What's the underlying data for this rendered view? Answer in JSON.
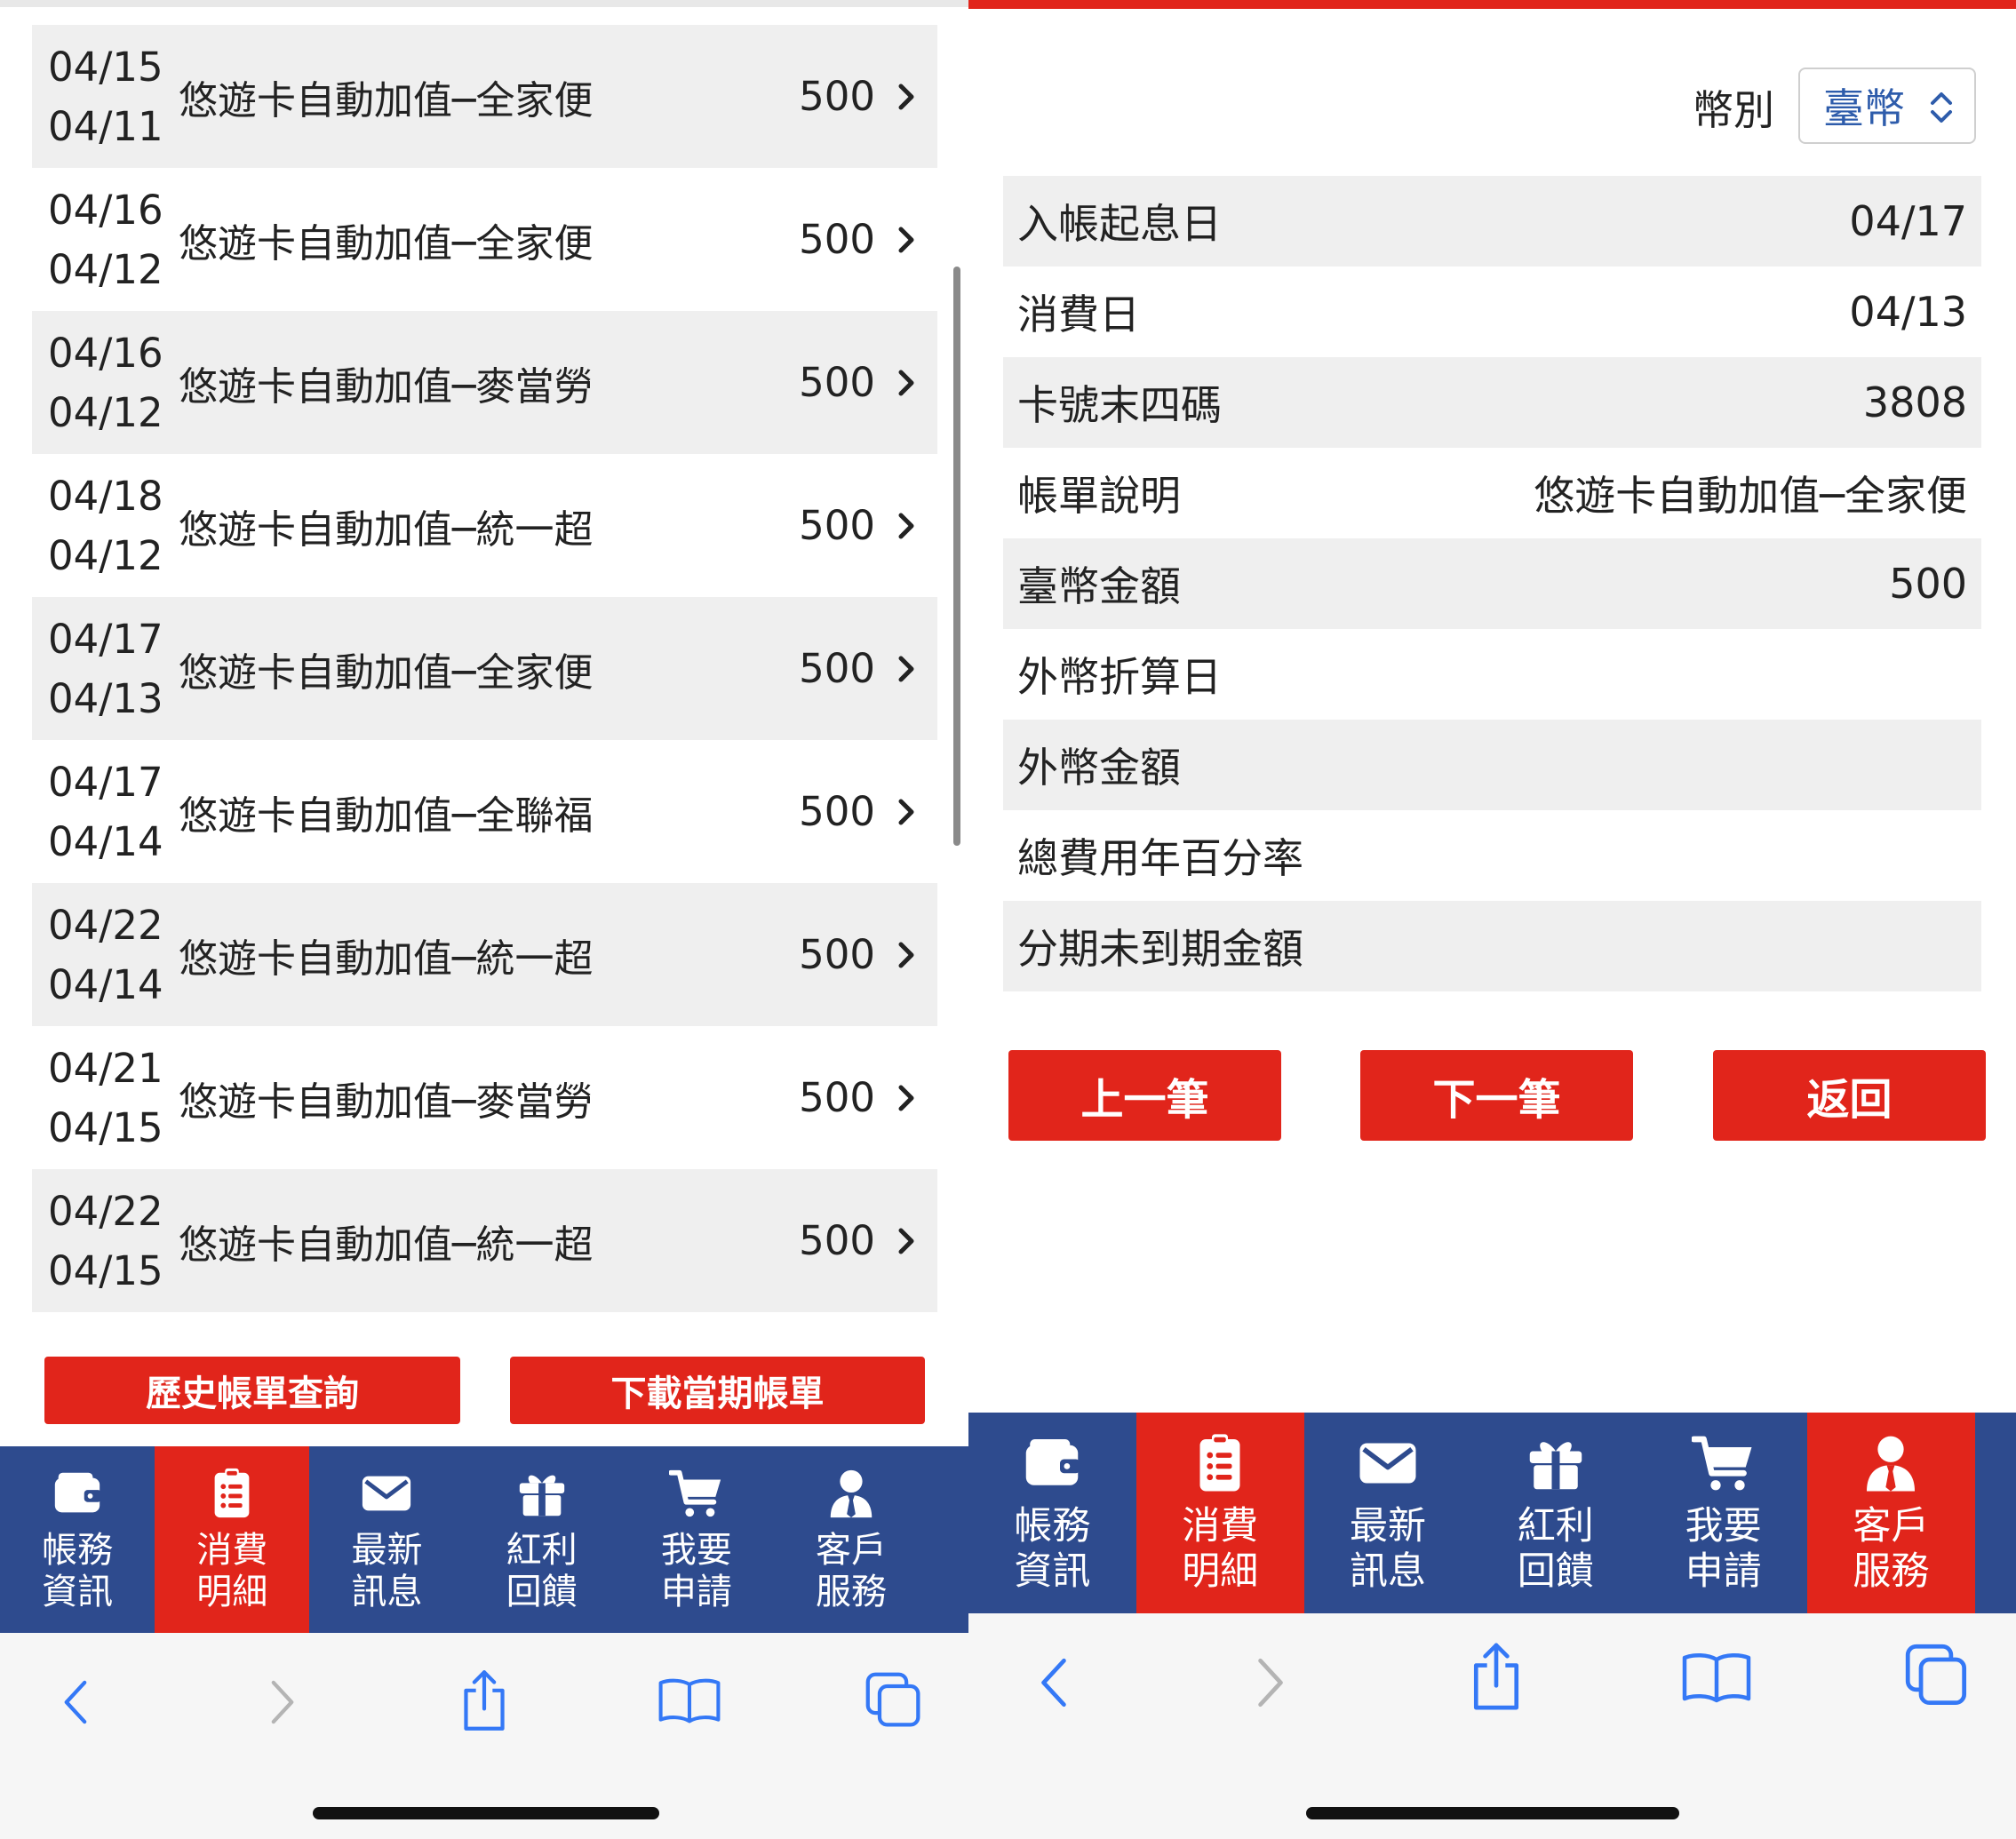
{
  "left": {
    "transactions": [
      {
        "post_date": "04/15",
        "txn_date": "04/11",
        "description": "悠遊卡自動加值─全家便",
        "amount": "500"
      },
      {
        "post_date": "04/16",
        "txn_date": "04/12",
        "description": "悠遊卡自動加值─全家便",
        "amount": "500"
      },
      {
        "post_date": "04/16",
        "txn_date": "04/12",
        "description": "悠遊卡自動加值─麥當勞",
        "amount": "500"
      },
      {
        "post_date": "04/18",
        "txn_date": "04/12",
        "description": "悠遊卡自動加值─統一超",
        "amount": "500"
      },
      {
        "post_date": "04/17",
        "txn_date": "04/13",
        "description": "悠遊卡自動加值─全家便",
        "amount": "500"
      },
      {
        "post_date": "04/17",
        "txn_date": "04/14",
        "description": "悠遊卡自動加值─全聯福",
        "amount": "500"
      },
      {
        "post_date": "04/22",
        "txn_date": "04/14",
        "description": "悠遊卡自動加值─統一超",
        "amount": "500"
      },
      {
        "post_date": "04/21",
        "txn_date": "04/15",
        "description": "悠遊卡自動加值─麥當勞",
        "amount": "500"
      },
      {
        "post_date": "04/22",
        "txn_date": "04/15",
        "description": "悠遊卡自動加值─統一超",
        "amount": "500"
      }
    ],
    "history_button": "歷史帳單查詢",
    "download_button": "下載當期帳單"
  },
  "tabs": [
    {
      "line1": "帳務",
      "line2": "資訊",
      "icon": "wallet-icon"
    },
    {
      "line1": "消費",
      "line2": "明細",
      "icon": "clipboard-list-icon"
    },
    {
      "line1": "最新",
      "line2": "訊息",
      "icon": "envelope-icon"
    },
    {
      "line1": "紅利",
      "line2": "回饋",
      "icon": "gift-icon"
    },
    {
      "line1": "我要",
      "line2": "申請",
      "icon": "cart-icon"
    },
    {
      "line1": "客戶",
      "line2": "服務",
      "icon": "user-tie-icon"
    }
  ],
  "right": {
    "currency_label": "幣別",
    "currency_value": "臺幣",
    "details": [
      {
        "label": "入帳起息日",
        "value": "04/17"
      },
      {
        "label": "消費日",
        "value": "04/13"
      },
      {
        "label": "卡號末四碼",
        "value": "3808"
      },
      {
        "label": "帳單說明",
        "value": "悠遊卡自動加值─全家便"
      },
      {
        "label": "臺幣金額",
        "value": "500"
      },
      {
        "label": "外幣折算日",
        "value": ""
      },
      {
        "label": "外幣金額",
        "value": ""
      },
      {
        "label": "總費用年百分率",
        "value": ""
      },
      {
        "label": "分期未到期金額",
        "value": ""
      }
    ],
    "prev_button": "上一筆",
    "next_button": "下一筆",
    "back_button": "返回"
  },
  "colors": {
    "brand_red": "#e1251b",
    "tabbar_blue": "#2e4b8e",
    "link_blue": "#2e5cab",
    "row_gray": "#efefef"
  }
}
